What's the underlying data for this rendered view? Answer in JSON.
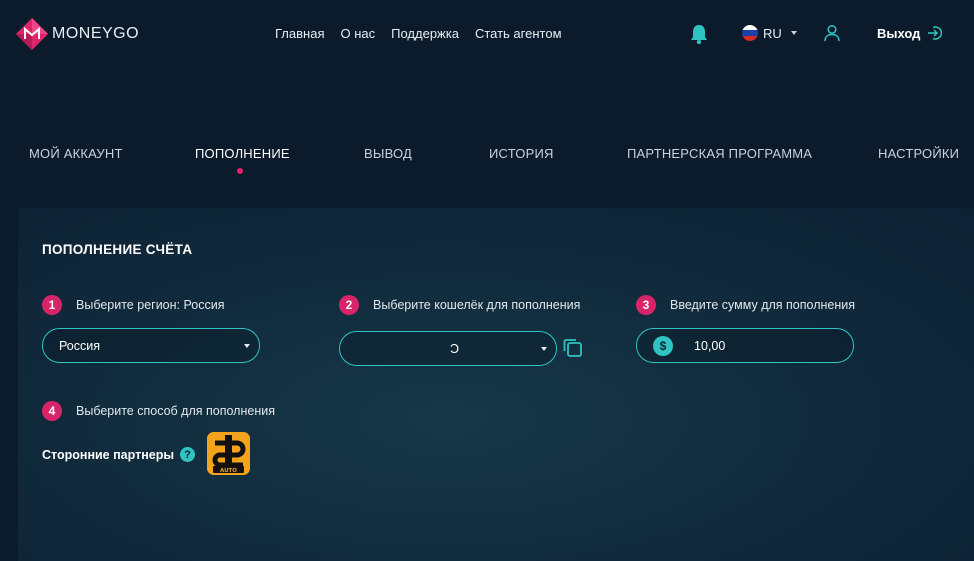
{
  "header": {
    "logo_text": "MONEYGO",
    "nav": [
      "Главная",
      "О нас",
      "Поддержка",
      "Стать агентом"
    ],
    "language": "RU",
    "logout_label": "Выход"
  },
  "tabs": [
    {
      "label": "МОЙ АККАУНТ",
      "active": false
    },
    {
      "label": "ПОПОЛНЕНИЕ",
      "active": true
    },
    {
      "label": "ВЫВОД",
      "active": false
    },
    {
      "label": "ИСТОРИЯ",
      "active": false
    },
    {
      "label": "ПАРТНЕРСКАЯ ПРОГРАММА",
      "active": false
    },
    {
      "label": "НАСТРОЙКИ",
      "active": false
    }
  ],
  "main": {
    "title": "ПОПОЛНЕНИЕ СЧЁТА",
    "step1": {
      "number": "1",
      "label": "Выберите регион: Россия",
      "value": "Россия"
    },
    "step2": {
      "number": "2",
      "label": "Выберите кошелёк для пополнения",
      "value": "Ɔ"
    },
    "step3": {
      "number": "3",
      "label": "Введите сумму для пополнения",
      "currency_symbol": "$",
      "value": "10,00"
    },
    "step4": {
      "number": "4",
      "label": "Выберите способ для пополнения"
    },
    "partners_label": "Сторонние партнеры",
    "help_symbol": "?",
    "partner_logo_text": "AUTO"
  },
  "colors": {
    "accent": "#d8256a",
    "teal": "#2fc4c2",
    "background": "#0c1b2b"
  }
}
